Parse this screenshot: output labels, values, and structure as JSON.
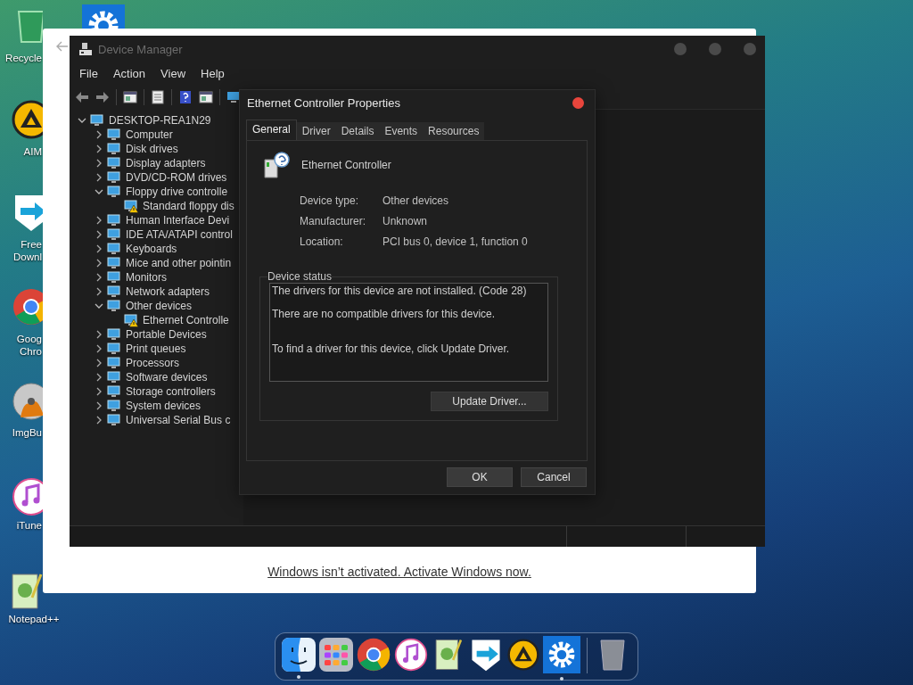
{
  "desktop_icons": [
    {
      "label": "Recycle"
    },
    {
      "label": "AIM"
    },
    {
      "label": "Free Downl"
    },
    {
      "label": "Goog Chro"
    },
    {
      "label": "ImgBu"
    },
    {
      "label": "iTune"
    },
    {
      "label": "Notepad++"
    }
  ],
  "activation_window": {
    "link": "Windows isn’t activated. Activate Windows now."
  },
  "device_manager": {
    "title": "Device Manager",
    "menu": [
      "File",
      "Action",
      "View",
      "Help"
    ],
    "tree": {
      "label": "DESKTOP-REA1N29",
      "expanded": true,
      "warning": false,
      "children": [
        {
          "label": "Computer",
          "expanded": false,
          "warning": false
        },
        {
          "label": "Disk drives",
          "expanded": false,
          "warning": false
        },
        {
          "label": "Display adapters",
          "expanded": false,
          "warning": false
        },
        {
          "label": "DVD/CD-ROM drives",
          "expanded": false,
          "warning": false
        },
        {
          "label": "Floppy drive controlle",
          "expanded": true,
          "warning": false,
          "children": [
            {
              "label": "Standard floppy dis",
              "warning": true
            }
          ]
        },
        {
          "label": "Human Interface Devi",
          "expanded": false,
          "warning": false
        },
        {
          "label": "IDE ATA/ATAPI control",
          "expanded": false,
          "warning": false
        },
        {
          "label": "Keyboards",
          "expanded": false,
          "warning": false
        },
        {
          "label": "Mice and other pointin",
          "expanded": false,
          "warning": false
        },
        {
          "label": "Monitors",
          "expanded": false,
          "warning": false
        },
        {
          "label": "Network adapters",
          "expanded": false,
          "warning": false
        },
        {
          "label": "Other devices",
          "expanded": true,
          "warning": false,
          "children": [
            {
              "label": "Ethernet Controlle",
              "warning": true
            }
          ]
        },
        {
          "label": "Portable Devices",
          "expanded": false,
          "warning": false
        },
        {
          "label": "Print queues",
          "expanded": false,
          "warning": false
        },
        {
          "label": "Processors",
          "expanded": false,
          "warning": false
        },
        {
          "label": "Software devices",
          "expanded": false,
          "warning": false
        },
        {
          "label": "Storage controllers",
          "expanded": false,
          "warning": false
        },
        {
          "label": "System devices",
          "expanded": false,
          "warning": false
        },
        {
          "label": "Universal Serial Bus c",
          "expanded": false,
          "warning": false
        }
      ]
    }
  },
  "properties_dialog": {
    "title": "Ethernet Controller Properties",
    "tabs": [
      {
        "label": "General",
        "selected": true
      },
      {
        "label": "Driver",
        "selected": false
      },
      {
        "label": "Details",
        "selected": false
      },
      {
        "label": "Events",
        "selected": false
      },
      {
        "label": "Resources",
        "selected": false
      }
    ],
    "device_name": "Ethernet Controller",
    "properties": [
      {
        "label": "Device type:",
        "value": "Other devices"
      },
      {
        "label": "Manufacturer:",
        "value": "Unknown"
      },
      {
        "label": "Location:",
        "value": "PCI bus 0, device 1, function 0"
      }
    ],
    "status_group": "Device status",
    "status_lines": [
      "The drivers for this device are not installed. (Code 28)",
      "There are no compatible drivers for this device.",
      "To find a driver for this device, click Update Driver."
    ],
    "update_button": "Update Driver...",
    "buttons": [
      "OK",
      "Cancel"
    ]
  },
  "dock": {
    "items": [
      {
        "running": true
      },
      {
        "running": false
      },
      {
        "running": false
      },
      {
        "running": false
      },
      {
        "running": false
      },
      {
        "running": false
      },
      {
        "running": false
      },
      {
        "running": true
      },
      {
        "running": false
      }
    ]
  }
}
